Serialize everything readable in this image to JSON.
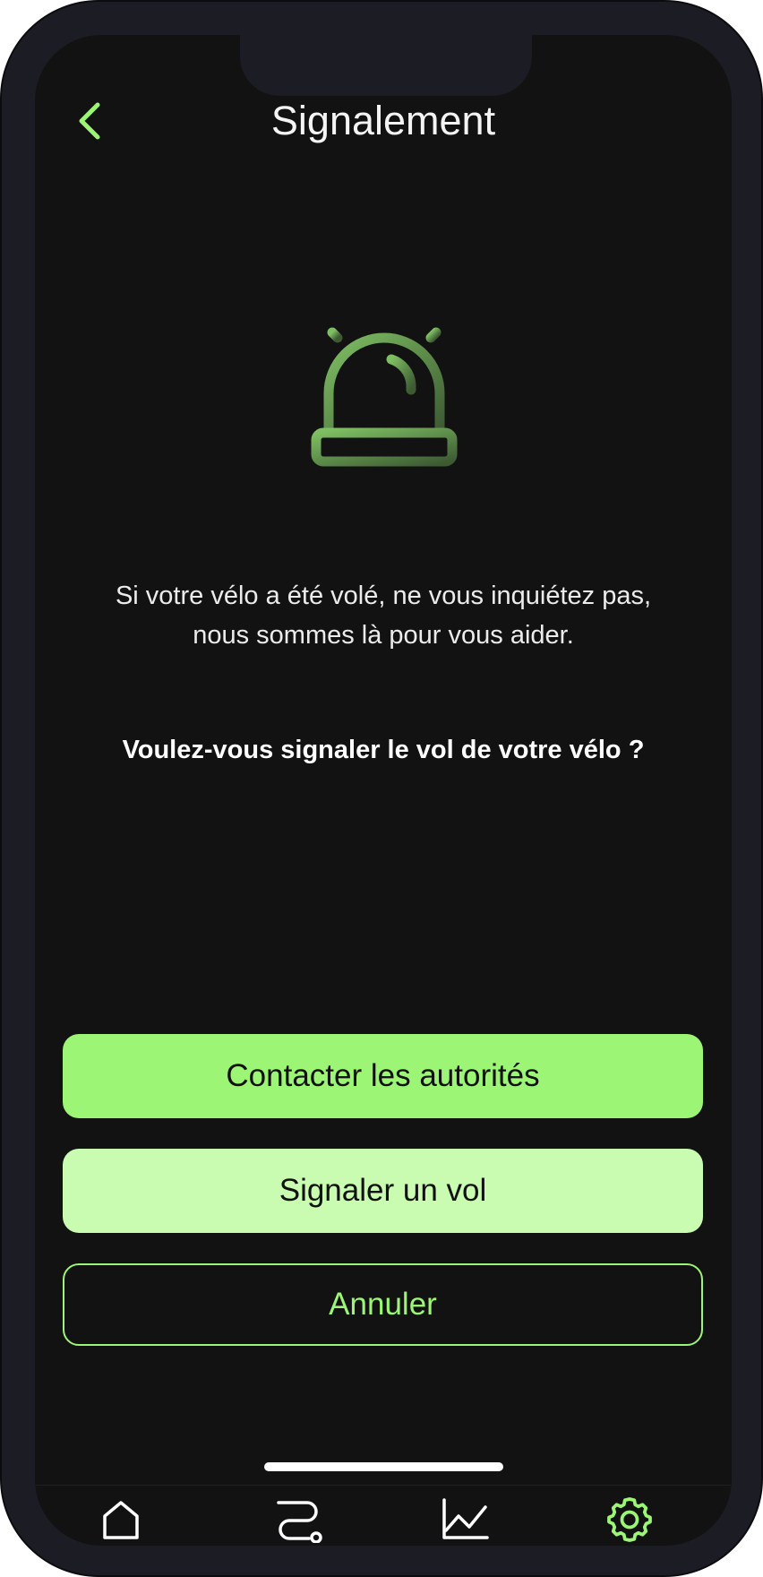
{
  "header": {
    "title": "Signalement",
    "back_icon": "chevron-left-icon"
  },
  "hero": {
    "icon": "alarm-siren-icon"
  },
  "content": {
    "message_line1": "Si votre vélo a été volé, ne vous inquiétez pas,",
    "message_line2": "nous sommes là pour vous aider.",
    "question": "Voulez-vous signaler le vol de votre vélo ?"
  },
  "actions": {
    "contact_label": "Contacter les autorités",
    "report_label": "Signaler un vol",
    "cancel_label": "Annuler"
  },
  "tabbar": {
    "items": [
      {
        "icon": "home-icon",
        "active": false
      },
      {
        "icon": "route-icon",
        "active": false
      },
      {
        "icon": "stats-chart-icon",
        "active": false
      },
      {
        "icon": "gear-icon",
        "active": true
      }
    ]
  },
  "colors": {
    "accent": "#9cf574",
    "accent_light": "#c9fbb0",
    "background": "#121212",
    "frame": "#1b1c24"
  }
}
